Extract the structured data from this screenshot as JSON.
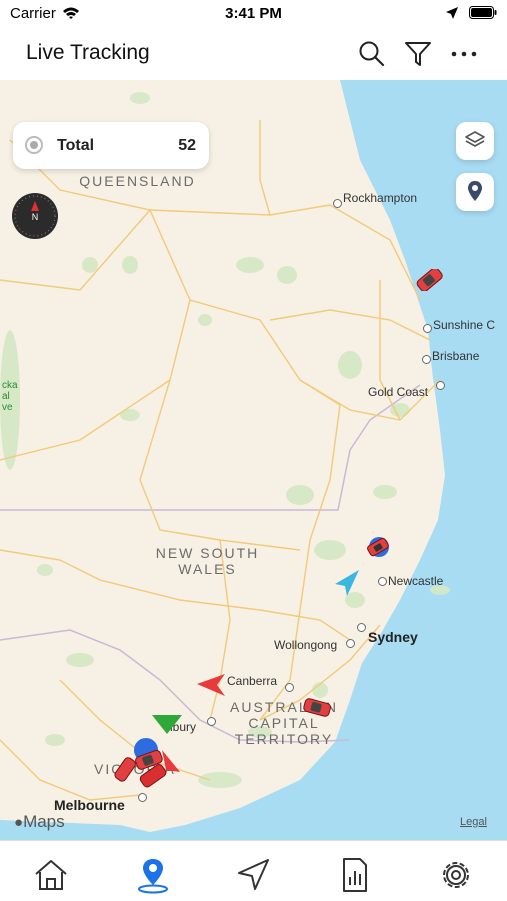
{
  "status_bar": {
    "carrier": "Carrier",
    "time": "3:41 PM"
  },
  "nav": {
    "title": "Live Tracking",
    "icons": [
      "search-icon",
      "filter-icon",
      "more-icon"
    ]
  },
  "total_card": {
    "label": "Total",
    "count": "52"
  },
  "map": {
    "regions": [
      {
        "name": "queensland",
        "text": "QUEENSLAND"
      },
      {
        "name": "nsw",
        "text": "NEW SOUTH\nWALES"
      },
      {
        "name": "act",
        "text": "AUSTRALIAN\nCAPITAL\nTERRITORY"
      },
      {
        "name": "victoria",
        "text": "VICTORIA"
      }
    ],
    "cities": [
      {
        "name": "rockhampton",
        "text": "Rockhampton"
      },
      {
        "name": "sunshine-coast",
        "text": "Sunshine C"
      },
      {
        "name": "brisbane",
        "text": "Brisbane"
      },
      {
        "name": "gold-coast",
        "text": "Gold Coast"
      },
      {
        "name": "newcastle",
        "text": "Newcastle"
      },
      {
        "name": "sydney",
        "text": "Sydney"
      },
      {
        "name": "wollongong",
        "text": "Wollongong"
      },
      {
        "name": "canberra",
        "text": "Canberra"
      },
      {
        "name": "albury",
        "text": "lbury"
      },
      {
        "name": "melbourne",
        "text": "Melbourne"
      }
    ],
    "edge_label": "cka\nal\nve",
    "maps_logo": "Maps",
    "legal": "Legal"
  },
  "tabbar": {
    "tabs": [
      "home-icon",
      "map-pin-icon",
      "navigation-icon",
      "report-icon",
      "settings-icon"
    ],
    "active_index": 1
  },
  "colors": {
    "accent": "#1a73e8",
    "water": "#a8dcf3",
    "land": "#f6f1e4",
    "park": "#d4e8c4",
    "road": "#f3c97a"
  }
}
